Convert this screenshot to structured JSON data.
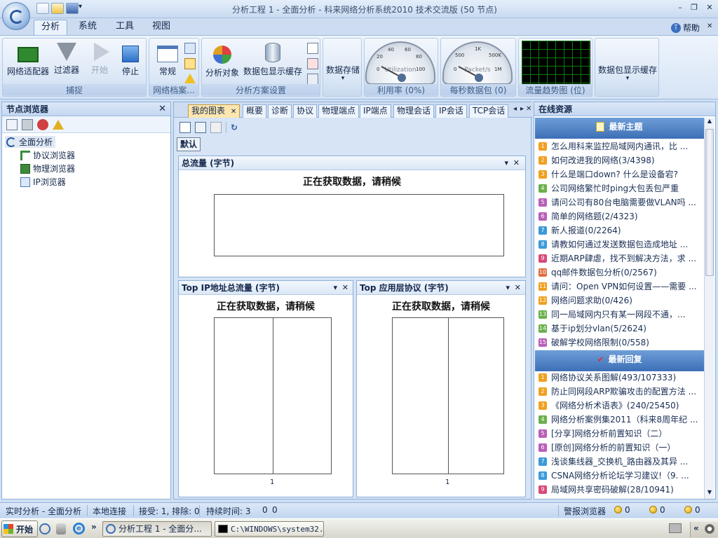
{
  "window": {
    "title": "分析工程 1 - 全面分析 - 科来网络分析系统2010 技术交流版 (50 节点)",
    "minimize": "–",
    "restore": "❐",
    "close": "✕",
    "ribbon_minimize": "–",
    "ribbon_restore": "▫",
    "ribbon_close": "✕"
  },
  "ribbon_tabs": [
    "分析",
    "系统",
    "工具",
    "视图"
  ],
  "help_label": "帮助",
  "ribbon": {
    "capture": {
      "label": "捕捉",
      "buttons": [
        "网络适配器",
        "过滤器",
        "开始",
        "停止"
      ]
    },
    "profile": {
      "label": "网络档案...",
      "button": "常规"
    },
    "scheme": {
      "label": "分析方案设置",
      "buttons": [
        "分析对象",
        "数据包显示缓存"
      ]
    },
    "storage": {
      "button": "数据存储",
      "arrow": "▾"
    },
    "util": {
      "label": "利用率 (0%)",
      "gauge_text": "Utilization",
      "ticks": [
        "0",
        "20",
        "40",
        "60",
        "80",
        "100"
      ],
      "value_pct": 0
    },
    "pps": {
      "label": "每秒数据包 (0)",
      "gauge_text": "Packet/s",
      "ticks": [
        "0",
        "500",
        "1K",
        "500K",
        "1M"
      ],
      "value": 0
    },
    "trend": {
      "label": "流量趋势图 (位)"
    },
    "pkt_cache": {
      "button": "数据包显示缓存",
      "arrow": "▾"
    }
  },
  "left_panel": {
    "title": "节点浏览器",
    "close": "✕",
    "tree": {
      "root": "全面分析",
      "children": [
        "协议浏览器",
        "物理浏览器",
        "IP浏览器"
      ]
    }
  },
  "center": {
    "tabs": [
      "我的图表",
      "概要",
      "诊断",
      "协议",
      "物理端点",
      "IP端点",
      "物理会话",
      "IP会话",
      "TCP会话"
    ],
    "tab_close": "✕",
    "tab_nav": [
      "◂",
      "▸",
      "✕"
    ],
    "default_btn": "默认",
    "refresh": "↻",
    "views": [
      {
        "title": "总流量 (字节)",
        "loading": "正在获取数据，请稍候"
      },
      {
        "title": "Top IP地址总流量 (字节)",
        "loading": "正在获取数据，请稍候",
        "axis_tick": "1"
      },
      {
        "title": "Top 应用层协议 (字节)",
        "loading": "正在获取数据，请稍候",
        "axis_tick": "1"
      }
    ],
    "view_menu": "▾",
    "view_close": "✕"
  },
  "right_panel": {
    "title": "在线资源",
    "latest_topics": {
      "title": "最新主题",
      "items": [
        "怎么用科来监控局域网内通讯，比 ...",
        "如何改进我的网络(3/4398)",
        "什么是端口down? 什么是设备宕?",
        "公司网络繁忙时ping大包丢包严重",
        "请问公司有80台电脑需要做VLAN吗 ...",
        "简单的网络题(2/4323)",
        "新人报道(0/2264)",
        "请教如何通过发送数据包造成地址 ...",
        "近期ARP肆虐，找不到解决方法，求 ...",
        "qq邮件数据包分析(0/2567)",
        "请问：Open VPN如何设置——需要 ...",
        "网络问题求助(0/426)",
        "同一局域网内只有某一网段不通，...",
        "基于ip划分vlan(5/2624)",
        "破解学校网络限制(0/558)"
      ]
    },
    "latest_replies": {
      "title": "最新回复",
      "items": [
        "网络协议关系图解(493/107333)",
        "防止同网段ARP欺骗攻击的配置方法 ...",
        "《网络分析术语表》(240/25450)",
        "网络分析案例集2011（科来8周年纪 ...",
        "[分享]网络分析前置知识（二）",
        "[原创]网络分析的前置知识（一）",
        "浅谈集线器_交换机_路由器及其异 ...",
        "CSNA网络分析论坛学习建议!（9. ...",
        "局域网共享密码破解(28/10941)"
      ]
    },
    "item_numbers": [
      "1",
      "2",
      "3",
      "4",
      "5",
      "6",
      "7",
      "8",
      "9",
      "10",
      "11",
      "12",
      "13",
      "14",
      "15"
    ],
    "reply_numbers": [
      "1",
      "2",
      "3",
      "4",
      "5",
      "6",
      "7",
      "8",
      "9"
    ]
  },
  "statusbar": {
    "mode": "实时分析 - 全面分析",
    "conn": "本地连接",
    "recv": "接受: 1, 排除: 0",
    "dur": "持续时间: 3",
    "c1": "0",
    "c2": "0",
    "alarm": "警报浏览器",
    "a1": "0",
    "a2": "0",
    "a3": "0"
  },
  "taskbar": {
    "start": "开始",
    "more": "»",
    "tasks": [
      "分析工程 1 - 全面分...",
      "C:\\WINDOWS\\system32..."
    ],
    "tray_more": "«"
  },
  "colors": {
    "accent": "#3d6fb7",
    "tab_active": "#fbe6b0",
    "trend_grid": "#0b7a0b"
  }
}
